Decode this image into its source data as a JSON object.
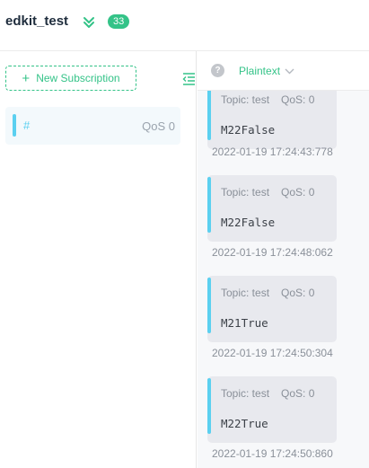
{
  "header": {
    "connection_name": "edkit_test",
    "message_count": "33"
  },
  "sidebar": {
    "new_subscription_label": "New Subscription",
    "subscriptions": [
      {
        "topic": "#",
        "qos": "QoS 0",
        "color": "#5bd0f0"
      }
    ]
  },
  "toolbar": {
    "payload_format": "Plaintext"
  },
  "messages": [
    {
      "topic": "Topic: test",
      "qos": "QoS: 0",
      "payload": "M22False",
      "time": "2022-01-19 17:24:43:778"
    },
    {
      "topic": "Topic: test",
      "qos": "QoS: 0",
      "payload": "M22False",
      "time": "2022-01-19 17:24:48:062"
    },
    {
      "topic": "Topic: test",
      "qos": "QoS: 0",
      "payload": "M21True",
      "time": "2022-01-19 17:24:50:304"
    },
    {
      "topic": "Topic: test",
      "qos": "QoS: 0",
      "payload": "M22True",
      "time": "2022-01-19 17:24:50:860"
    }
  ],
  "colors": {
    "accent_green": "#34c388",
    "topic_cyan": "#5bd0f0"
  },
  "icons": [
    "double-chevron-down-icon",
    "plus-icon",
    "collapse-sidebar-icon",
    "help-icon",
    "chevron-down-icon"
  ]
}
